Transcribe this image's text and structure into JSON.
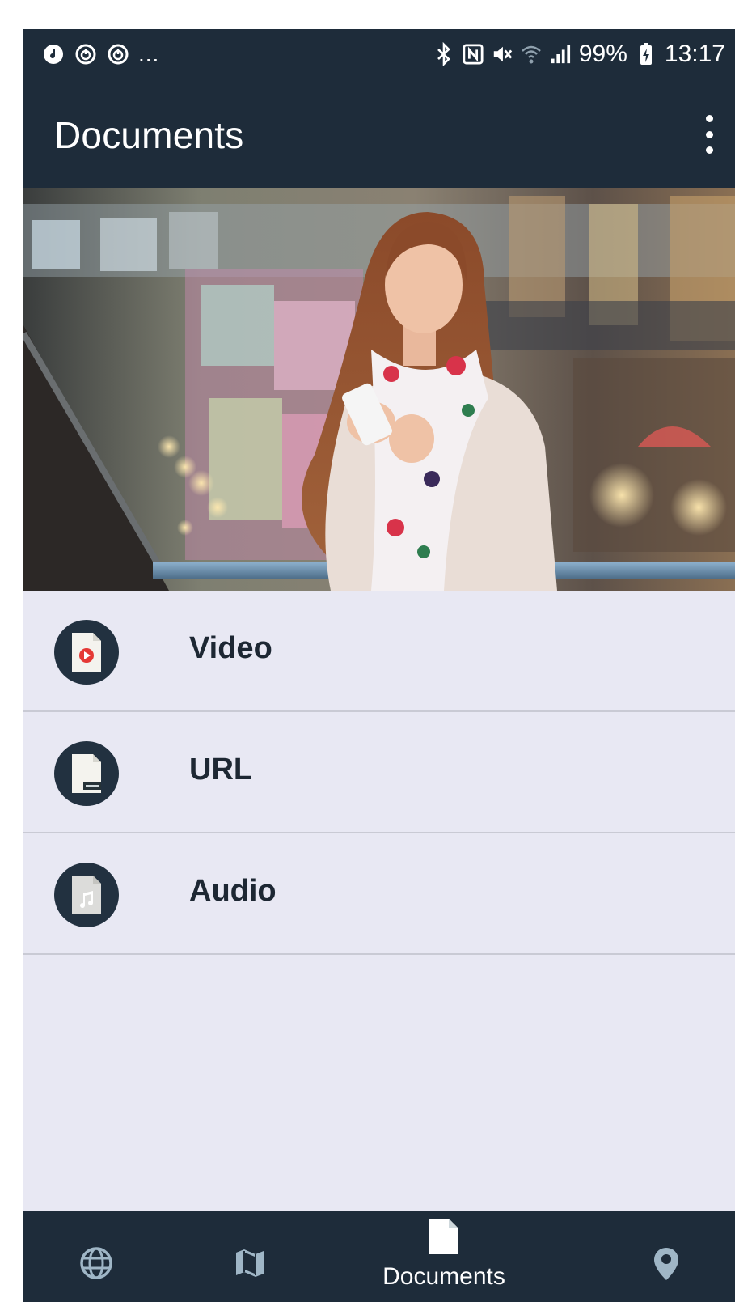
{
  "status_bar": {
    "left_icons": [
      "music-note-icon",
      "power-ring-icon",
      "power-ring-icon"
    ],
    "overflow": "...",
    "right_icons": [
      "bluetooth-icon",
      "nfc-icon",
      "mute-icon",
      "wifi-icon",
      "signal-icon"
    ],
    "battery": "99%",
    "time": "13:17"
  },
  "app_bar": {
    "title": "Documents",
    "menu_icon": "more-vertical-icon"
  },
  "hero": {
    "image": "woman-using-smartphone-photo"
  },
  "documents": [
    {
      "label": "Video",
      "icon": "video-file-icon",
      "accent": "#e53935"
    },
    {
      "label": "URL",
      "icon": "html-file-icon"
    },
    {
      "label": "Audio",
      "icon": "audio-file-icon"
    }
  ],
  "bottom_nav": {
    "items": [
      {
        "icon": "globe-icon",
        "label": ""
      },
      {
        "icon": "map-icon",
        "label": ""
      },
      {
        "icon": "document-icon",
        "label": "Documents",
        "active": true
      },
      {
        "icon": "location-pin-icon",
        "label": ""
      }
    ]
  },
  "colors": {
    "bar": "#1e2c3a",
    "background": "#e8e8f3",
    "inactive_icon": "#9fb6c6"
  }
}
